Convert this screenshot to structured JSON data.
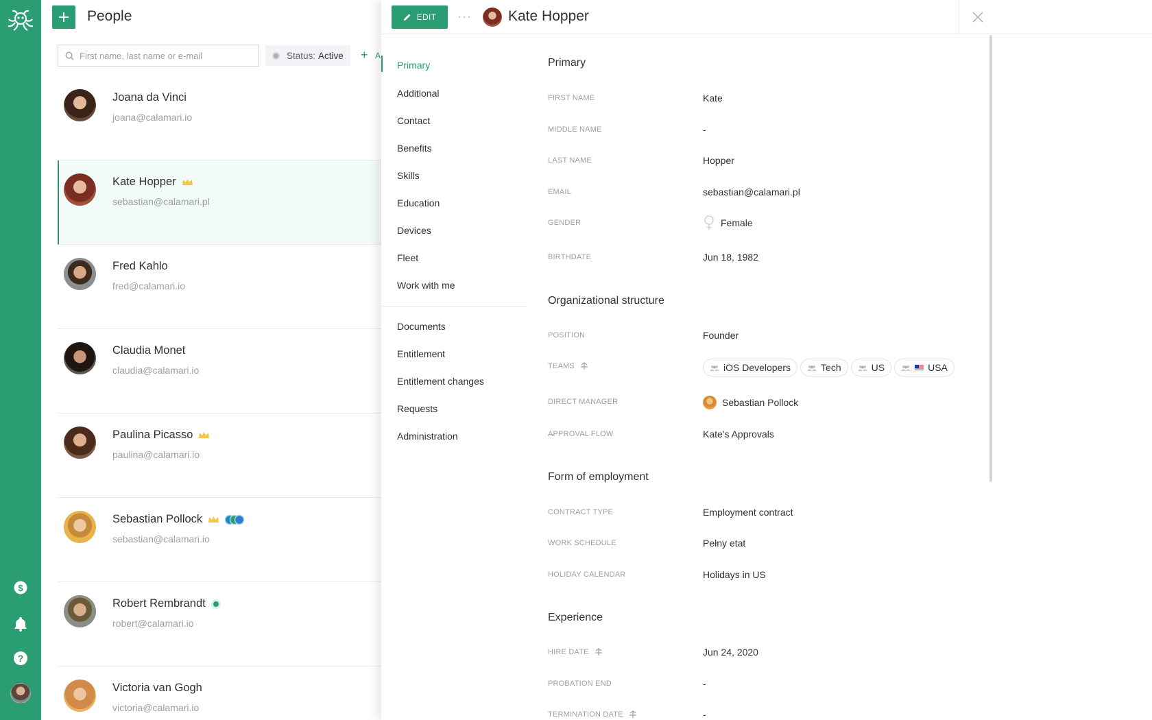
{
  "rail": {
    "logo_icon": "octopus-logo-icon",
    "items": [
      {
        "icon": "dollar-icon"
      },
      {
        "icon": "bell-icon"
      },
      {
        "icon": "help-icon"
      }
    ],
    "brand_color": "#2a9d72"
  },
  "list": {
    "title": "People",
    "search_placeholder": "First name, last name or e-mail",
    "status_filter_label": "Status:",
    "status_filter_value": "Active",
    "add_filter_label": "A",
    "people": [
      {
        "name": "Joana da Vinci",
        "email": "joana@calamari.io",
        "badges": []
      },
      {
        "name": "Kate Hopper",
        "email": "sebastian@calamari.pl",
        "badges": [
          "crown"
        ],
        "selected": true
      },
      {
        "name": "Fred Kahlo",
        "email": "fred@calamari.io",
        "badges": []
      },
      {
        "name": "Claudia Monet",
        "email": "claudia@calamari.io",
        "badges": []
      },
      {
        "name": "Paulina Picasso",
        "email": "paulina@calamari.io",
        "badges": [
          "crown"
        ]
      },
      {
        "name": "Sebastian Pollock",
        "email": "sebastian@calamari.io",
        "badges": [
          "crown",
          "team-badges"
        ]
      },
      {
        "name": "Robert Rembrandt",
        "email": "robert@calamari.io",
        "badges": [
          "green-badge"
        ]
      },
      {
        "name": "Victoria van Gogh",
        "email": "victoria@calamari.io",
        "badges": []
      }
    ]
  },
  "drawer": {
    "edit_label": "EDIT",
    "more_label": "···",
    "person_name": "Kate Hopper",
    "nav_primary": [
      "Primary",
      "Additional",
      "Contact",
      "Benefits",
      "Skills",
      "Education",
      "Devices",
      "Fleet",
      "Work with me"
    ],
    "nav_secondary": [
      "Documents",
      "Entitlement",
      "Entitlement changes",
      "Requests",
      "Administration"
    ],
    "sections": {
      "primary": {
        "title": "Primary",
        "first_name_label": "FIRST NAME",
        "first_name": "Kate",
        "middle_name_label": "MIDDLE NAME",
        "middle_name": "-",
        "last_name_label": "LAST NAME",
        "last_name": "Hopper",
        "email_label": "EMAIL",
        "email": "sebastian@calamari.pl",
        "gender_label": "GENDER",
        "gender": "Female",
        "birthdate_label": "BIRTHDATE",
        "birthdate": "Jun 18, 1982"
      },
      "org": {
        "title": "Organizational structure",
        "position_label": "POSITION",
        "position": "Founder",
        "teams_label": "TEAMS",
        "teams": [
          "iOS Developers",
          "Tech",
          "US",
          "USA"
        ],
        "manager_label": "DIRECT MANAGER",
        "manager": "Sebastian Pollock",
        "approval_label": "APPROVAL FLOW",
        "approval": "Kate's Approvals"
      },
      "employment": {
        "title": "Form of employment",
        "contract_label": "CONTRACT TYPE",
        "contract": "Employment contract",
        "schedule_label": "WORK SCHEDULE",
        "schedule": "Pełny etat",
        "holiday_label": "HOLIDAY CALENDAR",
        "holiday": "Holidays in US"
      },
      "experience": {
        "title": "Experience",
        "hire_label": "HIRE DATE",
        "hire": "Jun 24, 2020",
        "probation_label": "PROBATION END",
        "probation": "-",
        "termination_label": "TERMINATION DATE",
        "termination": "-"
      }
    }
  }
}
